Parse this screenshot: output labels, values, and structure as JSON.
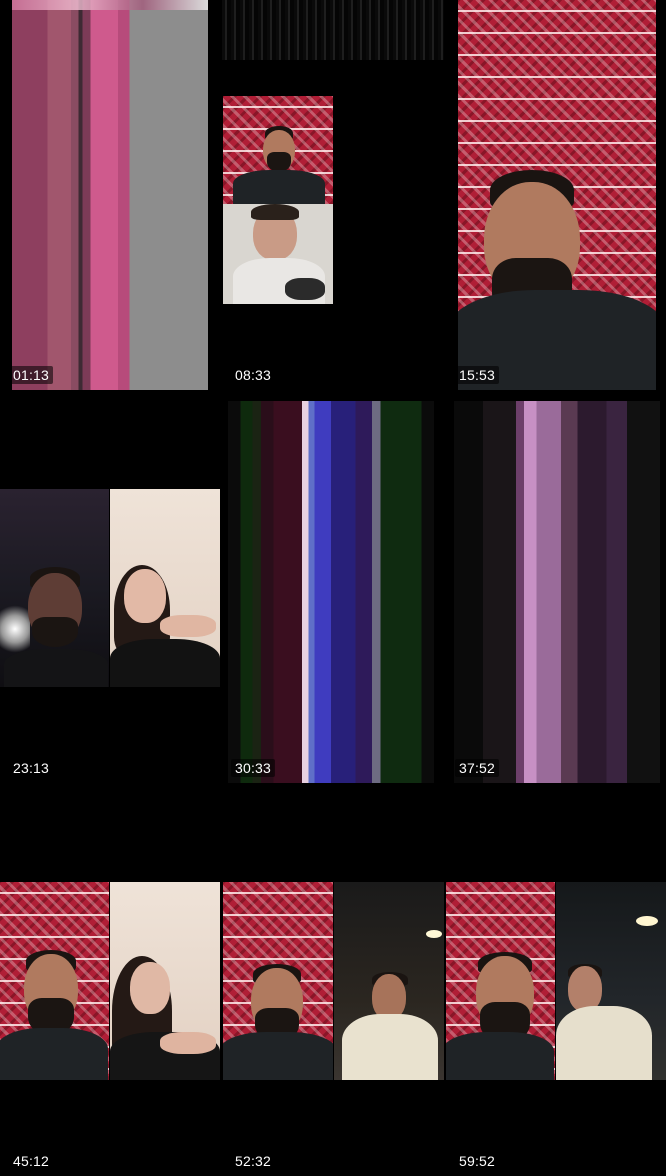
{
  "tiles": [
    {
      "timestamp": "01:13"
    },
    {
      "timestamp": "08:33"
    },
    {
      "timestamp": "15:53"
    },
    {
      "timestamp": "23:13"
    },
    {
      "timestamp": "30:33"
    },
    {
      "timestamp": "37:52"
    },
    {
      "timestamp": "45:12"
    },
    {
      "timestamp": "52:32"
    },
    {
      "timestamp": "59:52"
    }
  ],
  "colors": {
    "background": "#000000",
    "rug_red": "#b01e36",
    "timestamp_text": "#ffffff"
  },
  "icons": {
    "glitch_stripes": "glitch-stripes-icon"
  }
}
